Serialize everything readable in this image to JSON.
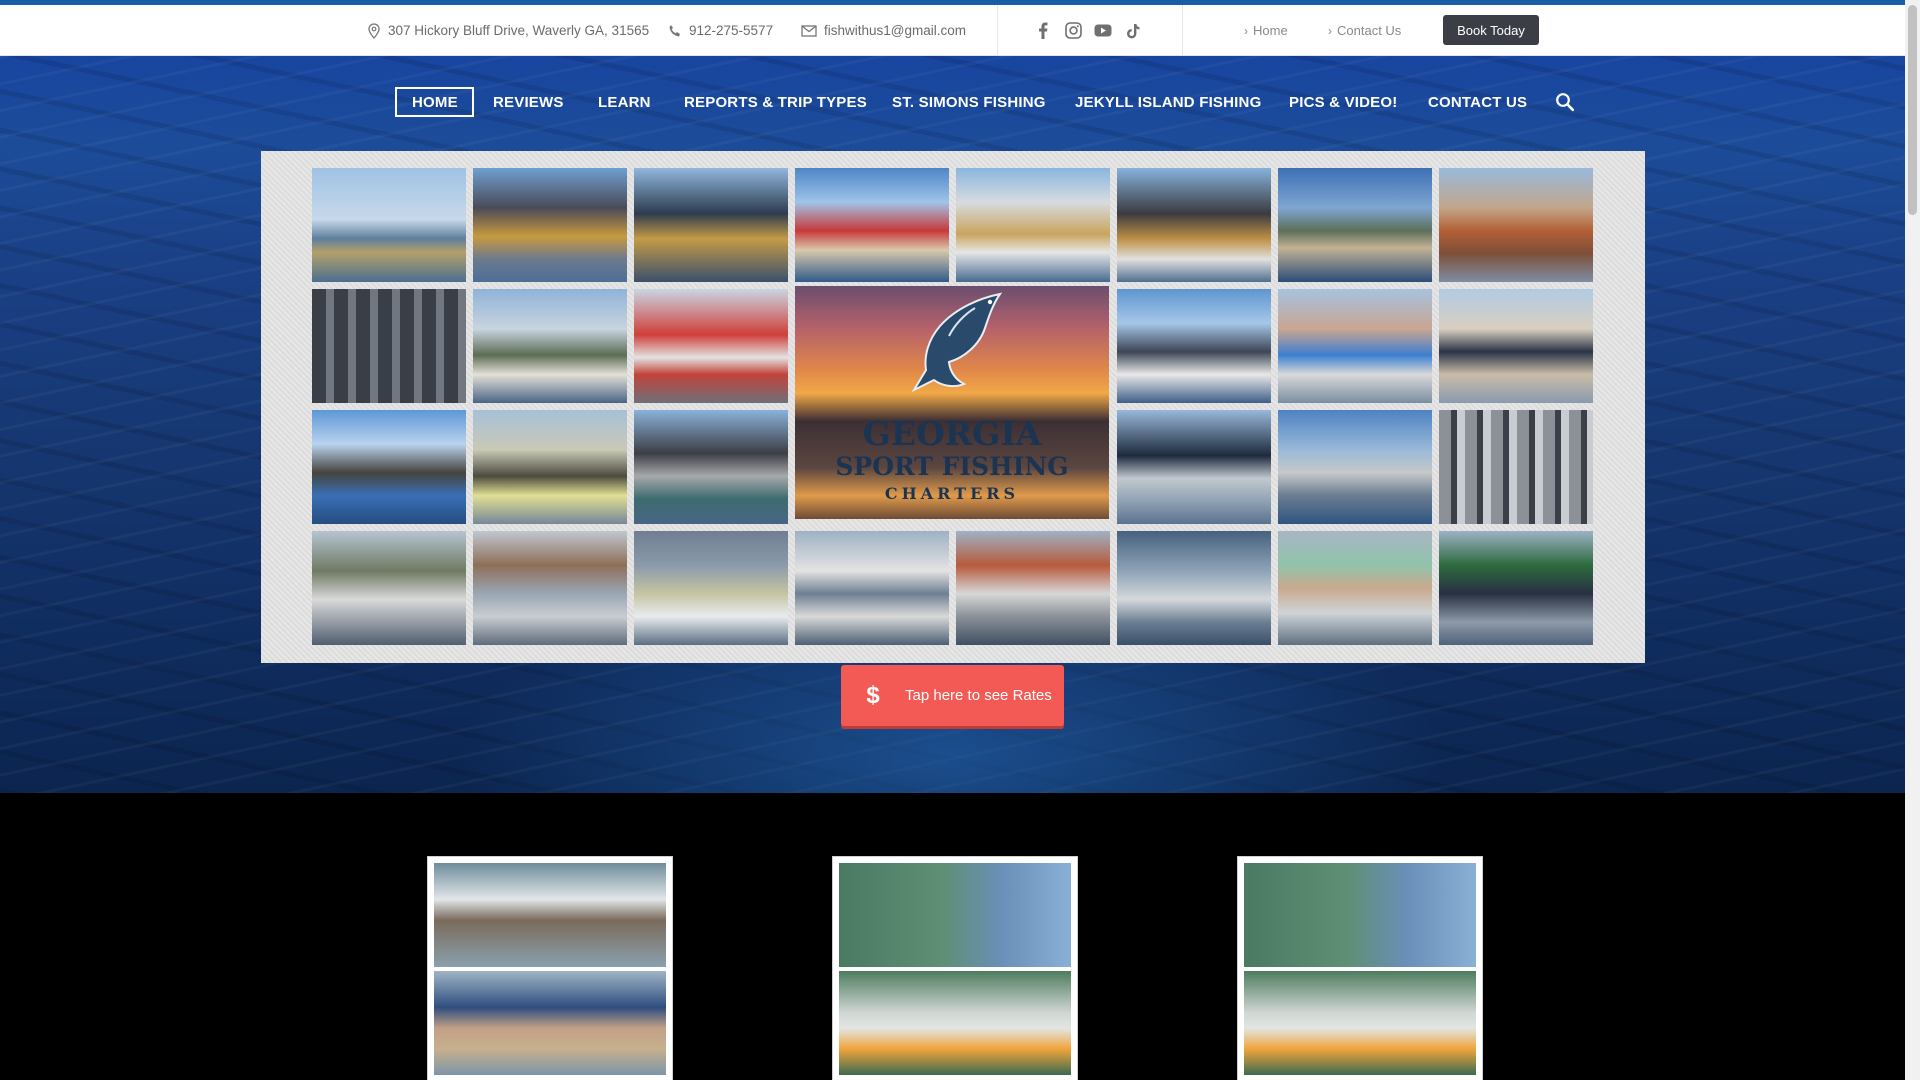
{
  "topbar": {
    "address": "307 Hickory Bluff Drive, Waverly GA, 31565",
    "phone": "912-275-5577",
    "email": "fishwithus1@gmail.com",
    "social_icons": [
      "facebook-icon",
      "instagram-icon",
      "youtube-icon",
      "tiktok-icon"
    ],
    "links": [
      "Home",
      "Contact Us"
    ],
    "book_label": "Book Today"
  },
  "nav": {
    "items": [
      "HOME",
      "REVIEWS",
      "LEARN",
      "REPORTS & TRIP TYPES",
      "ST. SIMONS FISHING",
      "JEKYLL ISLAND FISHING",
      "PICS & VIDEO!",
      "CONTACT US"
    ],
    "active": "HOME"
  },
  "logo": {
    "line1": "GEORGIA",
    "line2": "SPORT FISHING",
    "line3": "CHARTERS"
  },
  "rates_button": {
    "label": "Tap here to see Rates"
  },
  "colors": {
    "accent": "#1b5ea8",
    "rates_button": "#f45a55",
    "book_button": "#3b3e44"
  }
}
